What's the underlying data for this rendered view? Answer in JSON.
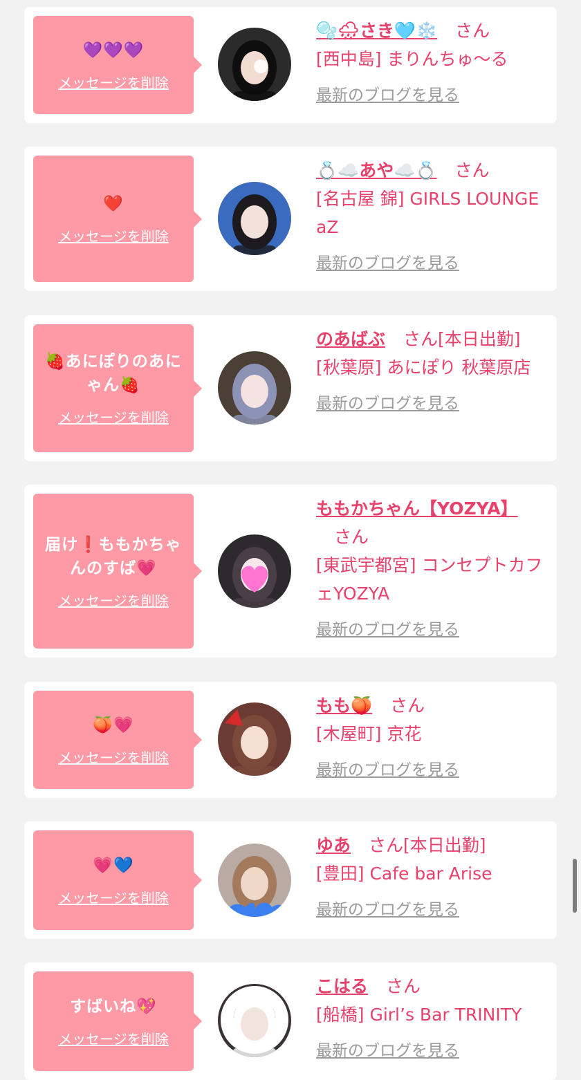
{
  "delete_label": "メッセージを削除",
  "san_label": "さん",
  "blog_label": "最新のブログを見る",
  "colors": {
    "bubble": "#fe99a6",
    "accent": "#e8416b",
    "link_gray": "#9b9b9b",
    "page_bg": "#f2f2f2"
  },
  "cards": [
    {
      "message": "💜💜💜",
      "name": "🫧🌧さき🩵❄️",
      "status": "",
      "shop": "[西中島] まりんちゅ〜る",
      "avatar_icon": "avatar-photo-1"
    },
    {
      "message": "❤️",
      "name": "💍☁️あや☁️💍",
      "status": "",
      "shop": "[名古屋 錦] GIRLS LOUNGE aZ",
      "avatar_icon": "avatar-photo-2"
    },
    {
      "message": "🍓あにぽりのあにゃん🍓",
      "name": "のあばぶ",
      "status": "[本日出勤]",
      "shop": "[秋葉原] あにぽり 秋葉原店",
      "avatar_icon": "avatar-photo-3"
    },
    {
      "message": "届け❗️ももかちゃんのすば💗",
      "name": "ももかちゃん【YOZYA】",
      "status": "",
      "shop": "[東武宇都宮] コンセプトカフェYOZYA",
      "avatar_icon": "avatar-photo-4"
    },
    {
      "message": "🍑💗",
      "name": "もも🍑",
      "status": "",
      "shop": "[木屋町] 京花",
      "avatar_icon": "avatar-photo-5"
    },
    {
      "message": "💗💙",
      "name": "ゆあ",
      "status": "[本日出勤]",
      "shop": "[豊田] Cafe bar Arise",
      "avatar_icon": "avatar-photo-6"
    },
    {
      "message": "すばいね💖",
      "name": "こはる",
      "status": "",
      "shop": "[船橋] Girl’s Bar TRINITY",
      "avatar_icon": "avatar-photo-7"
    }
  ]
}
